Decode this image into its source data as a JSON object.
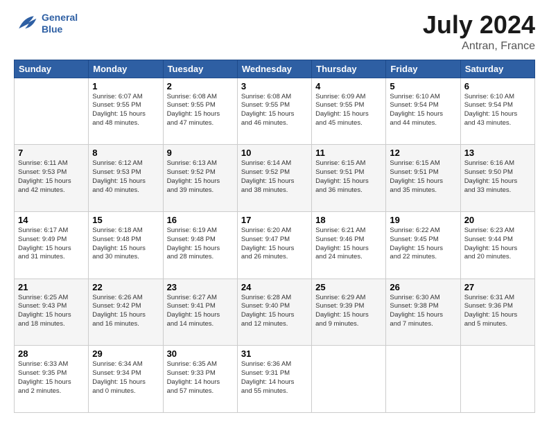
{
  "header": {
    "logo_line1": "General",
    "logo_line2": "Blue",
    "title": "July 2024",
    "subtitle": "Antran, France"
  },
  "columns": [
    "Sunday",
    "Monday",
    "Tuesday",
    "Wednesday",
    "Thursday",
    "Friday",
    "Saturday"
  ],
  "weeks": [
    {
      "shaded": false,
      "days": [
        {
          "num": "",
          "info": ""
        },
        {
          "num": "1",
          "info": "Sunrise: 6:07 AM\nSunset: 9:55 PM\nDaylight: 15 hours\nand 48 minutes."
        },
        {
          "num": "2",
          "info": "Sunrise: 6:08 AM\nSunset: 9:55 PM\nDaylight: 15 hours\nand 47 minutes."
        },
        {
          "num": "3",
          "info": "Sunrise: 6:08 AM\nSunset: 9:55 PM\nDaylight: 15 hours\nand 46 minutes."
        },
        {
          "num": "4",
          "info": "Sunrise: 6:09 AM\nSunset: 9:55 PM\nDaylight: 15 hours\nand 45 minutes."
        },
        {
          "num": "5",
          "info": "Sunrise: 6:10 AM\nSunset: 9:54 PM\nDaylight: 15 hours\nand 44 minutes."
        },
        {
          "num": "6",
          "info": "Sunrise: 6:10 AM\nSunset: 9:54 PM\nDaylight: 15 hours\nand 43 minutes."
        }
      ]
    },
    {
      "shaded": true,
      "days": [
        {
          "num": "7",
          "info": "Sunrise: 6:11 AM\nSunset: 9:53 PM\nDaylight: 15 hours\nand 42 minutes."
        },
        {
          "num": "8",
          "info": "Sunrise: 6:12 AM\nSunset: 9:53 PM\nDaylight: 15 hours\nand 40 minutes."
        },
        {
          "num": "9",
          "info": "Sunrise: 6:13 AM\nSunset: 9:52 PM\nDaylight: 15 hours\nand 39 minutes."
        },
        {
          "num": "10",
          "info": "Sunrise: 6:14 AM\nSunset: 9:52 PM\nDaylight: 15 hours\nand 38 minutes."
        },
        {
          "num": "11",
          "info": "Sunrise: 6:15 AM\nSunset: 9:51 PM\nDaylight: 15 hours\nand 36 minutes."
        },
        {
          "num": "12",
          "info": "Sunrise: 6:15 AM\nSunset: 9:51 PM\nDaylight: 15 hours\nand 35 minutes."
        },
        {
          "num": "13",
          "info": "Sunrise: 6:16 AM\nSunset: 9:50 PM\nDaylight: 15 hours\nand 33 minutes."
        }
      ]
    },
    {
      "shaded": false,
      "days": [
        {
          "num": "14",
          "info": "Sunrise: 6:17 AM\nSunset: 9:49 PM\nDaylight: 15 hours\nand 31 minutes."
        },
        {
          "num": "15",
          "info": "Sunrise: 6:18 AM\nSunset: 9:48 PM\nDaylight: 15 hours\nand 30 minutes."
        },
        {
          "num": "16",
          "info": "Sunrise: 6:19 AM\nSunset: 9:48 PM\nDaylight: 15 hours\nand 28 minutes."
        },
        {
          "num": "17",
          "info": "Sunrise: 6:20 AM\nSunset: 9:47 PM\nDaylight: 15 hours\nand 26 minutes."
        },
        {
          "num": "18",
          "info": "Sunrise: 6:21 AM\nSunset: 9:46 PM\nDaylight: 15 hours\nand 24 minutes."
        },
        {
          "num": "19",
          "info": "Sunrise: 6:22 AM\nSunset: 9:45 PM\nDaylight: 15 hours\nand 22 minutes."
        },
        {
          "num": "20",
          "info": "Sunrise: 6:23 AM\nSunset: 9:44 PM\nDaylight: 15 hours\nand 20 minutes."
        }
      ]
    },
    {
      "shaded": true,
      "days": [
        {
          "num": "21",
          "info": "Sunrise: 6:25 AM\nSunset: 9:43 PM\nDaylight: 15 hours\nand 18 minutes."
        },
        {
          "num": "22",
          "info": "Sunrise: 6:26 AM\nSunset: 9:42 PM\nDaylight: 15 hours\nand 16 minutes."
        },
        {
          "num": "23",
          "info": "Sunrise: 6:27 AM\nSunset: 9:41 PM\nDaylight: 15 hours\nand 14 minutes."
        },
        {
          "num": "24",
          "info": "Sunrise: 6:28 AM\nSunset: 9:40 PM\nDaylight: 15 hours\nand 12 minutes."
        },
        {
          "num": "25",
          "info": "Sunrise: 6:29 AM\nSunset: 9:39 PM\nDaylight: 15 hours\nand 9 minutes."
        },
        {
          "num": "26",
          "info": "Sunrise: 6:30 AM\nSunset: 9:38 PM\nDaylight: 15 hours\nand 7 minutes."
        },
        {
          "num": "27",
          "info": "Sunrise: 6:31 AM\nSunset: 9:36 PM\nDaylight: 15 hours\nand 5 minutes."
        }
      ]
    },
    {
      "shaded": false,
      "days": [
        {
          "num": "28",
          "info": "Sunrise: 6:33 AM\nSunset: 9:35 PM\nDaylight: 15 hours\nand 2 minutes."
        },
        {
          "num": "29",
          "info": "Sunrise: 6:34 AM\nSunset: 9:34 PM\nDaylight: 15 hours\nand 0 minutes."
        },
        {
          "num": "30",
          "info": "Sunrise: 6:35 AM\nSunset: 9:33 PM\nDaylight: 14 hours\nand 57 minutes."
        },
        {
          "num": "31",
          "info": "Sunrise: 6:36 AM\nSunset: 9:31 PM\nDaylight: 14 hours\nand 55 minutes."
        },
        {
          "num": "",
          "info": ""
        },
        {
          "num": "",
          "info": ""
        },
        {
          "num": "",
          "info": ""
        }
      ]
    }
  ]
}
